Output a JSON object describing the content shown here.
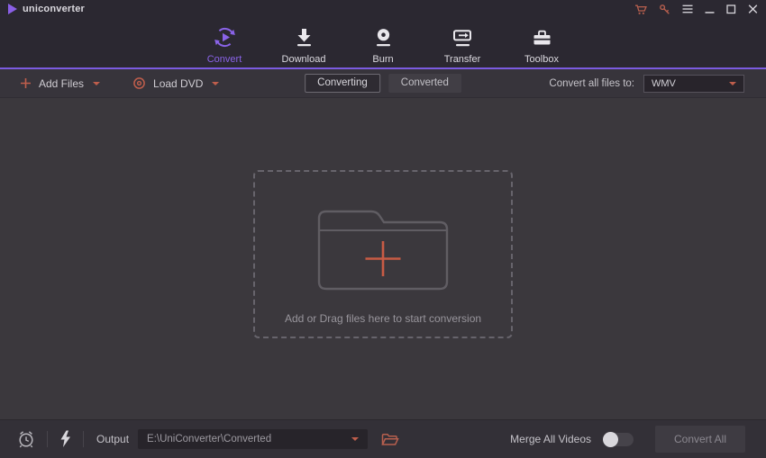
{
  "window": {
    "app_name": "uniconverter"
  },
  "nav": {
    "tabs": [
      {
        "label": "Convert",
        "active": true
      },
      {
        "label": "Download",
        "active": false
      },
      {
        "label": "Burn",
        "active": false
      },
      {
        "label": "Transfer",
        "active": false
      },
      {
        "label": "Toolbox",
        "active": false
      }
    ]
  },
  "toolbar": {
    "add_files": "Add Files",
    "load_dvd": "Load DVD",
    "queue_tabs": [
      {
        "label": "Converting",
        "active": true
      },
      {
        "label": "Converted",
        "active": false
      }
    ],
    "convert_all_files_to": "Convert all files to:",
    "selected_format": "WMV"
  },
  "dropzone": {
    "message": "Add or Drag files here to start conversion"
  },
  "footer": {
    "output_label": "Output",
    "output_path": "E:\\UniConverter\\Converted",
    "merge_all_videos": "Merge All Videos",
    "merge_enabled": false,
    "convert_all": "Convert All"
  },
  "icons": {
    "titlebar": [
      "store-cart-icon",
      "key-icon",
      "menu-icon",
      "minimize-icon",
      "maximize-icon",
      "close-icon"
    ],
    "footer": [
      "schedule-clock-icon",
      "high-speed-bolt-icon",
      "open-folder-icon"
    ]
  },
  "colors": {
    "accent_purple": "#7b5be0",
    "accent_red": "#bf5e4c",
    "background": "#3b383d"
  }
}
